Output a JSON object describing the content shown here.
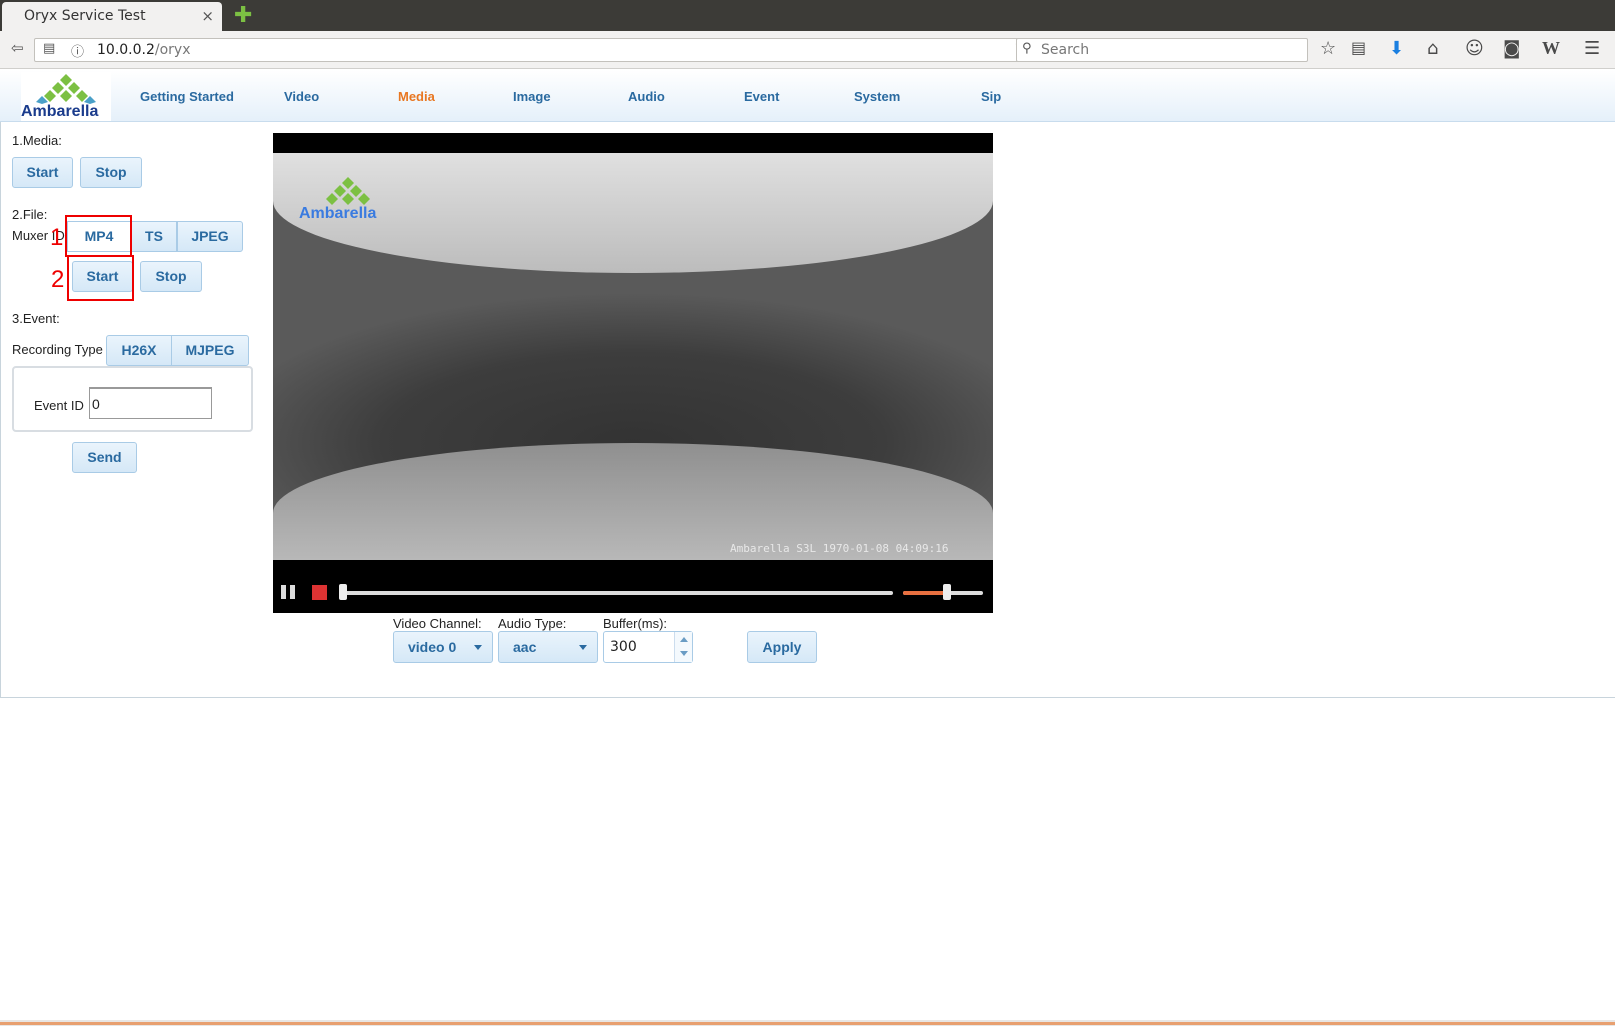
{
  "browser": {
    "tab_title": "Oryx Service Test",
    "tab_close": "×",
    "new_tab": "✚",
    "url_host": "10.0.0.2",
    "url_path": "/oryx",
    "search_placeholder": "Search"
  },
  "header": {
    "logo_text": "Ambarella",
    "menu": [
      "Getting Started",
      "Video",
      "Media",
      "Image",
      "Audio",
      "Event",
      "System",
      "Sip"
    ],
    "active_menu": "Media"
  },
  "media": {
    "section_label": "1.Media:",
    "start_label": "Start",
    "stop_label": "Stop"
  },
  "file": {
    "section_label": "2.File:",
    "muxer_label": "Muxer ID",
    "muxers": [
      "MP4",
      "TS",
      "JPEG"
    ],
    "start_label": "Start",
    "stop_label": "Stop",
    "annotation_1": "1",
    "annotation_2": "2"
  },
  "event": {
    "section_label": "3.Event:",
    "recording_type_label": "Recording Type",
    "recording_types": [
      "H26X",
      "MJPEG"
    ],
    "event_id_label": "Event ID",
    "event_id_value": "0",
    "send_label": "Send"
  },
  "player": {
    "overlay_logo": "Ambarella",
    "osd_text": "Ambarella S3L 1970-01-08 04:09:16",
    "seek_fraction": 0.0,
    "volume_fraction": 0.55
  },
  "stream": {
    "video_channel_label": "Video Channel:",
    "video_channel_value": "video 0",
    "audio_type_label": "Audio Type:",
    "audio_type_value": "aac",
    "buffer_label": "Buffer(ms):",
    "buffer_value": "300",
    "apply_label": "Apply"
  },
  "colors": {
    "accent": "#2a6aa0",
    "active": "#e87722",
    "highlight": "#ee0000"
  }
}
